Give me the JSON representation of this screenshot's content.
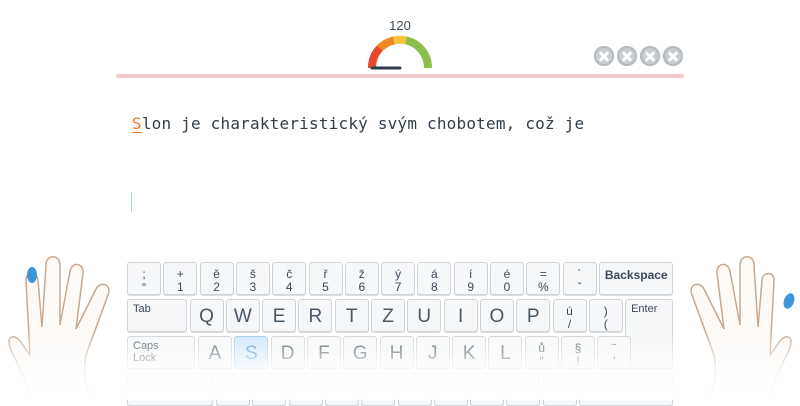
{
  "header": {
    "speed_value": "120",
    "gauge_colors": [
      "#e8482c",
      "#f08a28",
      "#f5c23a",
      "#8cc04a"
    ],
    "lives": [
      {
        "icon": "close-circle-icon"
      },
      {
        "icon": "close-circle-icon"
      },
      {
        "icon": "close-circle-icon"
      },
      {
        "icon": "close-circle-icon"
      }
    ]
  },
  "exercise": {
    "current_char": "S",
    "remaining_text": "lon je charakteristický svým chobotem, což je",
    "highlight_color": "#f07a2a"
  },
  "keyboard": {
    "active_key": "S",
    "active_color": "#cfe6fb",
    "row1": [
      {
        "top": ";",
        "bottom": "°"
      },
      {
        "top": "+",
        "bottom": "1"
      },
      {
        "top": "ě",
        "bottom": "2"
      },
      {
        "top": "š",
        "bottom": "3"
      },
      {
        "top": "č",
        "bottom": "4"
      },
      {
        "top": "ř",
        "bottom": "5"
      },
      {
        "top": "ž",
        "bottom": "6"
      },
      {
        "top": "ý",
        "bottom": "7"
      },
      {
        "top": "á",
        "bottom": "8"
      },
      {
        "top": "í",
        "bottom": "9"
      },
      {
        "top": "é",
        "bottom": "0"
      },
      {
        "top": "=",
        "bottom": "%"
      },
      {
        "top": "´",
        "bottom": "ˇ"
      }
    ],
    "backspace_label": "Backspace",
    "tab_label": "Tab",
    "row2": [
      "Q",
      "W",
      "E",
      "R",
      "T",
      "Z",
      "U",
      "I",
      "O",
      "P"
    ],
    "row2_extra": [
      {
        "top": "ú",
        "bottom": "/"
      },
      {
        "top": ")",
        "bottom": "("
      }
    ],
    "enter_label": "Enter",
    "caps_label": "Caps Lock",
    "row3": [
      "A",
      "S",
      "D",
      "F",
      "G",
      "H",
      "J",
      "K",
      "L"
    ],
    "row3_extra": [
      {
        "top": "ů",
        "bottom": "\""
      },
      {
        "top": "§",
        "bottom": "!"
      },
      {
        "top": "¨",
        "bottom": "'"
      }
    ]
  },
  "hands": {
    "left_active_finger": "pinky",
    "right_active_finger": "pinky",
    "finger_highlight_color": "#3d95d8",
    "skin_outline_color": "#c9a98f"
  }
}
